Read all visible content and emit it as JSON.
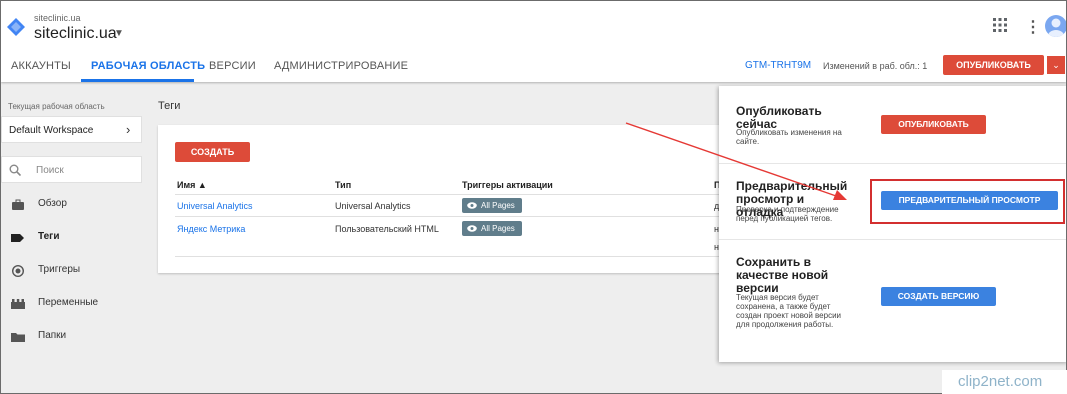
{
  "header": {
    "account_domain": "siteclinic.ua",
    "container_name": "siteclinic.ua",
    "tabs": [
      {
        "label": "АККАУНТЫ"
      },
      {
        "label": "РАБОЧАЯ ОБЛАСТЬ"
      },
      {
        "label": "ВЕРСИИ"
      },
      {
        "label": "АДМИНИСТРИРОВАНИЕ"
      }
    ],
    "container_id": "GTM-TRHT9M",
    "changes_text": "Изменений в раб. обл.: 1",
    "publish_label": "ОПУБЛИКОВАТЬ"
  },
  "sidebar": {
    "workspace_label": "Текущая рабочая область",
    "workspace_name": "Default Workspace",
    "search_placeholder": "Поиск",
    "items": [
      {
        "label": "Обзор",
        "icon": "briefcase-icon"
      },
      {
        "label": "Теги",
        "icon": "tag-icon"
      },
      {
        "label": "Триггеры",
        "icon": "trigger-icon"
      },
      {
        "label": "Переменные",
        "icon": "variables-icon"
      },
      {
        "label": "Папки",
        "icon": "folder-icon"
      }
    ]
  },
  "main": {
    "title": "Теги",
    "create_label": "СОЗДАТЬ",
    "columns": [
      "Имя ▲",
      "Тип",
      "Триггеры активации",
      "П"
    ],
    "rows": [
      {
        "name": "Universal Analytics",
        "type": "Universal Analytics",
        "trigger": "All Pages",
        "last": "д"
      },
      {
        "name": "Яндекс Метрика",
        "type": "Пользовательский HTML",
        "trigger": "All Pages",
        "last": "н"
      }
    ],
    "extra_last": "н"
  },
  "publish_menu": {
    "sections": [
      {
        "title": "Опубликовать сейчас",
        "desc": "Опубликовать изменения на сайте.",
        "button": "ОПУБЛИКОВАТЬ",
        "color": "#dd4b39"
      },
      {
        "title": "Предварительный просмотр и отладка",
        "desc": "Проверка и подтверждение перед публикацией тегов.",
        "button": "ПРЕДВАРИТЕЛЬНЫЙ ПРОСМОТР",
        "color": "#3b82e0"
      },
      {
        "title": "Сохранить в качестве новой версии",
        "desc": "Текущая версия будет сохранена, а также будет создан проект новой версии для продолжения работы.",
        "button": "СОЗДАТЬ ВЕРСИЮ",
        "color": "#3b82e0"
      }
    ]
  },
  "watermark": {
    "text": "clip2net.com"
  },
  "colors": {
    "accent": "#1a73e8",
    "publish": "#dd4b39",
    "chip": "#607d8b",
    "highlight": "#d32f2f"
  }
}
